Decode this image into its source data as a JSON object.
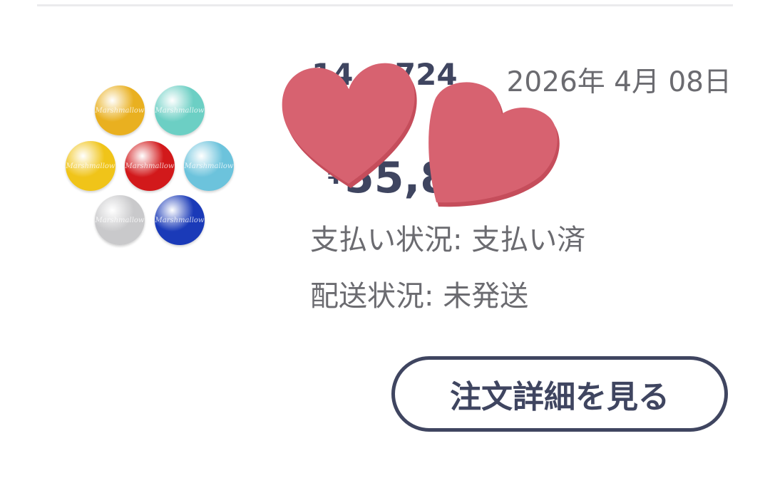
{
  "order": {
    "number_visible": "14    724",
    "date": "2026年 4月 08日",
    "price_currency": "¥",
    "price_visible": "55,88",
    "payment_status": "支払い状況: 支払い済",
    "shipping_status": "配送状況: 未発送",
    "detail_button_label": "注文詳細を見る"
  },
  "thumbnail": {
    "icon": "colored-balls-product-icon",
    "balls": [
      {
        "color": "#e9b020",
        "label": "Marshmallow"
      },
      {
        "color": "#6ccfc4",
        "label": "Marshmallow"
      },
      {
        "color": "#f0c419",
        "label": "Marshmallow"
      },
      {
        "color": "#d2191b",
        "label": "Marshmallow"
      },
      {
        "color": "#6cc3dc",
        "label": "Marshmallow"
      },
      {
        "color": "#c9c9cb",
        "label": "Marshmallow"
      },
      {
        "color": "#1a3ab8",
        "label": "Marshmallow"
      }
    ]
  },
  "stickers": {
    "icon": "heart-sticker-icon",
    "color": "#d76270"
  },
  "colors": {
    "accent": "#3f4560",
    "text_muted": "#6b6b70",
    "divider": "#ebebed"
  }
}
